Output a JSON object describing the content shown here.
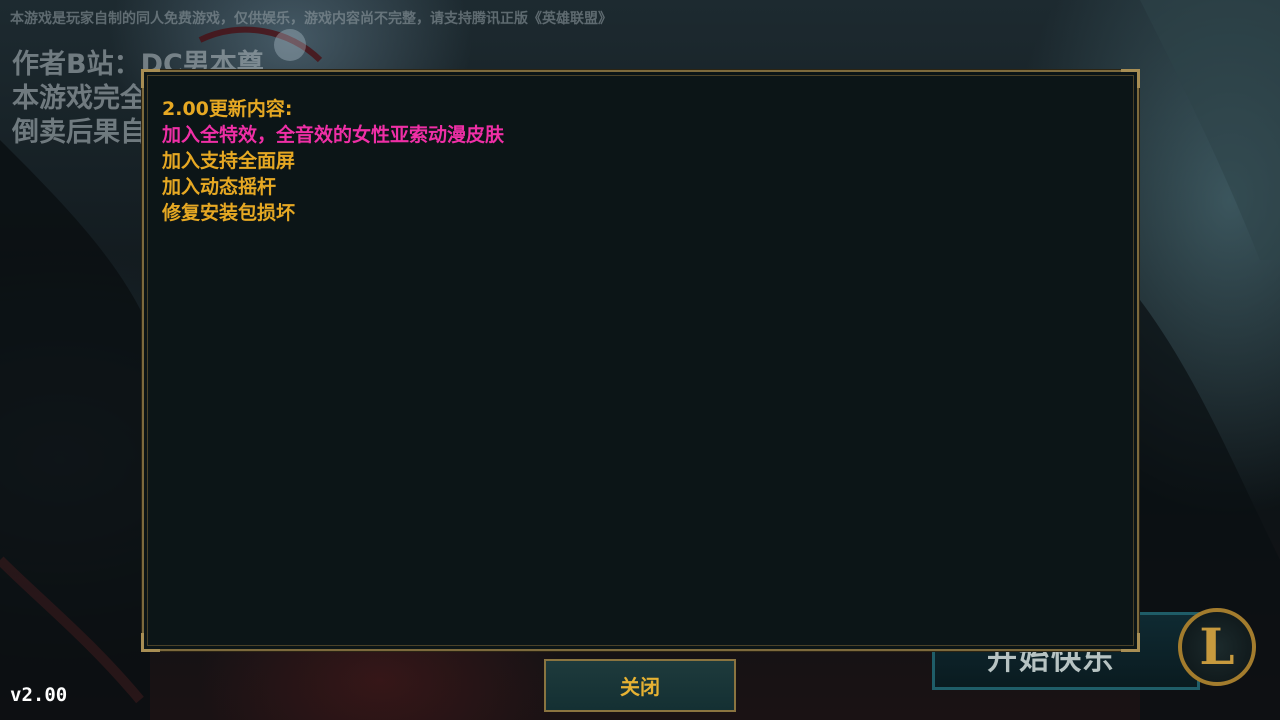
{
  "background": {
    "notice": "本游戏是玩家自制的同人免费游戏，仅供娱乐，游戏内容尚不完整，请支持腾讯正版《英雄联盟》",
    "author_lines": [
      "作者B站：DC男本尊",
      "本游戏完全免费",
      "倒卖后果自负"
    ],
    "start_button_label": "开始快乐",
    "logo_icon": "lol-logo-icon",
    "logo_letter": "L",
    "version": "v2.00"
  },
  "dialog": {
    "title": "2.00更新内容:",
    "items": [
      {
        "text": "加入全特效，全音效的女性亚索动漫皮肤",
        "color": "#ef2fa6"
      },
      {
        "text": "加入支持全面屏",
        "color": "#e6a823"
      },
      {
        "text": "加入动态摇杆",
        "color": "#e6a823"
      },
      {
        "text": "修复安装包损坏",
        "color": "#e6a823"
      }
    ],
    "close_label": "关闭"
  },
  "colors": {
    "accent_gold": "#e6a823",
    "highlight_pink": "#ef2fa6",
    "frame_gold": "#7d6a3d",
    "panel_bg": "#0c1517"
  }
}
